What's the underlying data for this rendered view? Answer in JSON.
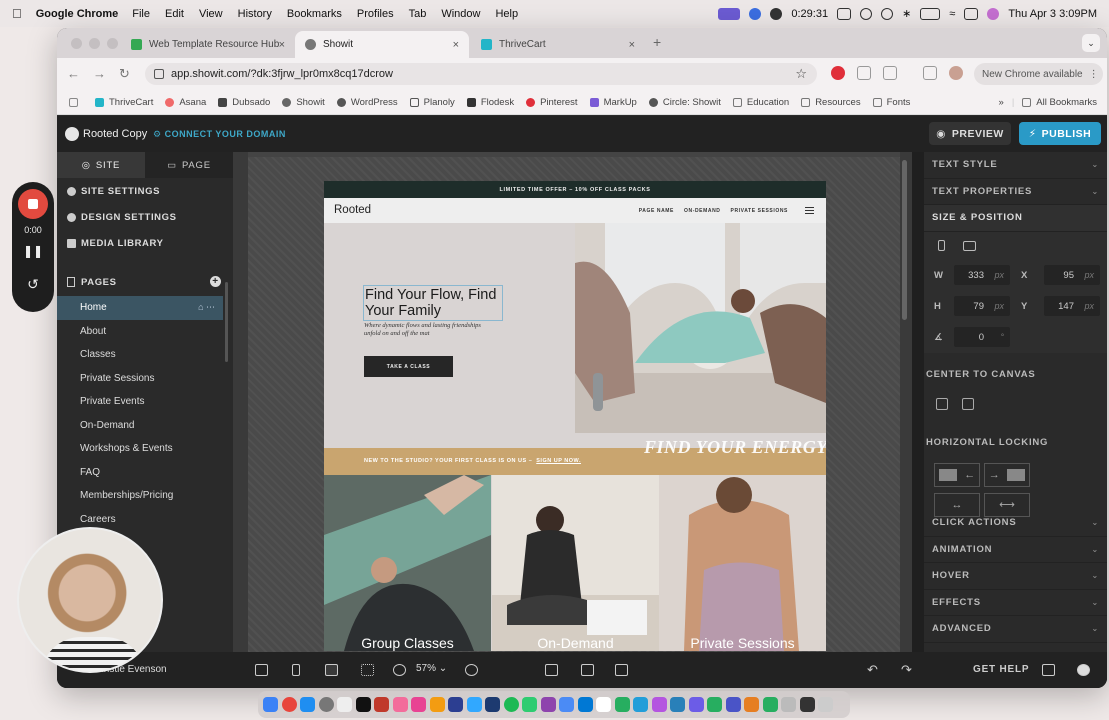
{
  "menubar": {
    "app": "Google Chrome",
    "items": [
      "File",
      "Edit",
      "View",
      "History",
      "Bookmarks",
      "Profiles",
      "Tab",
      "Window",
      "Help"
    ],
    "timer": "0:29:31",
    "clock": "Thu Apr 3  3:09PM"
  },
  "browser": {
    "tabs": [
      {
        "title": "Web Template Resource Hub",
        "favicon_color": "#34a853"
      },
      {
        "title": "Showit",
        "favicon_color": "#666666"
      },
      {
        "title": "ThriveCart",
        "favicon_color": "#23b5c8"
      }
    ],
    "url": "app.showit.com/?dk:3fjrw_lpr0mx8cq17dcrow",
    "new_chrome": "New Chrome available",
    "bookmarks": [
      "ThriveCart",
      "Asana",
      "Dubsado",
      "Showit",
      "WordPress",
      "Planoly",
      "Flodesk",
      "Pinterest",
      "MarkUp",
      "Circle: Showit",
      "Education",
      "Resources",
      "Fonts"
    ],
    "all_bookmarks": "All Bookmarks"
  },
  "editor": {
    "site_name": "Rooted Copy",
    "connect_domain": "CONNECT YOUR DOMAIN",
    "preview": "PREVIEW",
    "publish": "PUBLISH",
    "left_tabs": [
      "SITE",
      "PAGE"
    ],
    "settings": [
      "SITE SETTINGS",
      "DESIGN SETTINGS",
      "MEDIA LIBRARY"
    ],
    "pages_label": "PAGES",
    "pages": [
      "Home",
      "About",
      "Classes",
      "Private Sessions",
      "Private Events",
      "On-Demand",
      "Workshops & Events",
      "FAQ",
      "Memberships/Pricing",
      "Careers"
    ],
    "zoom": "57%",
    "get_help": "GET HELP",
    "user": "Christie Evenson"
  },
  "site_preview": {
    "banner": "LIMITED TIME OFFER – 10% OFF CLASS PACKS",
    "logo": "Rooted",
    "nav": [
      "PAGE NAME",
      "ON-DEMAND",
      "PRIVATE SESSIONS"
    ],
    "headline": "Find Your Flow, Find Your Family",
    "subheadline": "Where dynamic flows and lasting friendships unfold on and off the mat",
    "cta": "TAKE A CLASS",
    "promo": "NEW TO THE STUDIO? YOUR FIRST CLASS IS ON US –",
    "promo_link": "SIGN UP NOW.",
    "energy": "FIND YOUR ENERGY",
    "tiles": [
      "Group Classes",
      "On-Demand",
      "Private Sessions"
    ]
  },
  "right_panel": {
    "sections_top": [
      "TEXT STYLE",
      "TEXT PROPERTIES",
      "SIZE & POSITION"
    ],
    "fields": {
      "w_label": "W",
      "w": "333",
      "x_label": "X",
      "x": "95",
      "h_label": "H",
      "h": "79",
      "y_label": "Y",
      "y": "147",
      "rotation": "0",
      "unit": "px",
      "deg": "°"
    },
    "center_to_canvas": "CENTER TO CANVAS",
    "horizontal_locking": "HORIZONTAL LOCKING",
    "sections_bottom": [
      "CLICK ACTIONS",
      "ANIMATION",
      "HOVER",
      "EFFECTS",
      "ADVANCED"
    ]
  },
  "recorder": {
    "time": "0:00"
  },
  "colors": {
    "accent": "#2a9ac7",
    "gold": "#c9a56f",
    "record": "#e24a3f"
  }
}
